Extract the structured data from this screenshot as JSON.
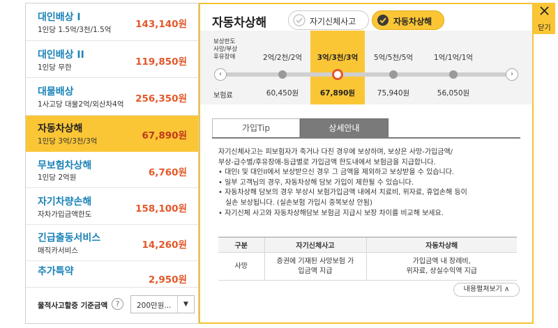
{
  "coverages": [
    {
      "name": "대인배상 I",
      "sub": "1인당 1.5억/3천/1.5억",
      "price": "143,140원"
    },
    {
      "name": "대인배상 II",
      "sub": "1인당 무한",
      "price": "119,850원"
    },
    {
      "name": "대물배상",
      "sub": "1사고당 대물2억/외산차4억",
      "price": "256,350원"
    },
    {
      "name": "자동차상해",
      "sub": "1인당 3억/3천/3억",
      "price": "67,890원"
    },
    {
      "name": "무보험차상해",
      "sub": "1인당 2억원",
      "price": "6,760원"
    },
    {
      "name": "자기차량손해",
      "sub": "자차가입금액한도",
      "price": "158,100원"
    },
    {
      "name": "긴급출동서비스",
      "sub": "매직카서비스",
      "price": "14,260원"
    },
    {
      "name": "추가특약",
      "sub": "",
      "price": "2,950원"
    }
  ],
  "footer": {
    "label": "물적사고할증 기준금액",
    "help": "?",
    "select_value": "200만원...",
    "arrow": "▼"
  },
  "panel": {
    "title": "자동차상해",
    "toggle_off": "자기신체사고",
    "toggle_on": "자동차상해",
    "limit_label": [
      "보상한도",
      "사망/부상",
      "후유장애"
    ],
    "premium_label": "보험료",
    "options": [
      {
        "limit": "2억/2천/2억",
        "premium": "60,450원"
      },
      {
        "limit": "3억/3천/3억",
        "premium": "67,890원"
      },
      {
        "limit": "5억/5천/5억",
        "premium": "75,940원"
      },
      {
        "limit": "1억/1억/1억",
        "premium": "56,050원"
      }
    ],
    "prev": "‹",
    "next": "›"
  },
  "tabs": {
    "tip": "가입Tip",
    "detail": "상세안내"
  },
  "detail": {
    "lines": [
      "자기신체사고는 피보험자가 죽거나 다친 경우에 보상하며, 보상은 사망-가입금액/",
      "부상-급수별/후유장애-등급별로 가입금액 한도내에서 보험금을 지급합니다."
    ],
    "bullets": [
      [
        "• 대인I 및 대인II에서 보상받으신 경우 그 금액을 제외하고 보상받을 수 있습니다."
      ],
      [
        "• 일부 고객님의 경우, 자동차상해 담보 가입이 제한될 수 있습니다."
      ],
      [
        "• 자동차상해 담보의 경우 부상시 보험가입금액 내에서 치료비, 위자료, 휴업손해 등이",
        "실손 보상됩니다. (실손보험 가입시 중복보상 안됨)"
      ],
      [
        "• 자기신체 사고와 자동차상해담보 보험금 지급시 보장 차이를 비교해 보세요."
      ]
    ],
    "table": {
      "headers": [
        "구분",
        "자기신체사고",
        "자동차상해"
      ],
      "rows": [
        {
          "cells": [
            [
              "사망"
            ],
            [
              "증권에 기재된 사망보험 가",
              "입금액 지급"
            ],
            [
              "가입금액 내 장례비,",
              "위자료, 상실수익액 지급"
            ]
          ]
        }
      ]
    },
    "fold": "내용펼쳐보기 ∧"
  },
  "close": {
    "label": "닫기"
  },
  "colors": {
    "accent": "#fbc636",
    "price": "#e2582a",
    "link": "#1a82b8"
  }
}
